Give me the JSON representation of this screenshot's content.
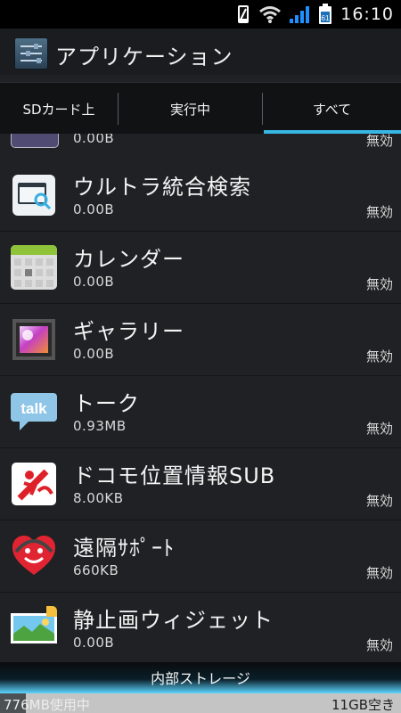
{
  "status_bar": {
    "time": "16:10",
    "battery_level": "61",
    "icons": [
      "phone-icon",
      "wifi-icon",
      "signal-icon",
      "battery-icon"
    ]
  },
  "app_bar": {
    "title": "アプリケーション",
    "icon": "settings-icon"
  },
  "tabs": [
    {
      "label": "SDカード上",
      "selected": false
    },
    {
      "label": "実行中",
      "selected": false
    },
    {
      "label": "すべて",
      "selected": true
    }
  ],
  "apps": [
    {
      "name": "",
      "size": "0.00B",
      "status": "無効",
      "icon": "partial-app-icon"
    },
    {
      "name": "ウルトラ統合検索",
      "size": "0.00B",
      "status": "無効",
      "icon": "search-window-icon"
    },
    {
      "name": "カレンダー",
      "size": "0.00B",
      "status": "無効",
      "icon": "calendar-icon"
    },
    {
      "name": "ギャラリー",
      "size": "0.00B",
      "status": "無効",
      "icon": "gallery-icon"
    },
    {
      "name": "トーク",
      "size": "0.93MB",
      "status": "無効",
      "icon": "talk-icon"
    },
    {
      "name": "ドコモ位置情報SUB",
      "size": "8.00KB",
      "status": "無効",
      "icon": "location-icon"
    },
    {
      "name": "遠隔ｻﾎﾟｰﾄ",
      "size": "660KB",
      "status": "無効",
      "icon": "heart-support-icon"
    },
    {
      "name": "静止画ウィジェット",
      "size": "0.00B",
      "status": "無効",
      "icon": "photo-widget-icon"
    }
  ],
  "storage": {
    "label": "内部ストレージ",
    "used_text": "776MB使用中",
    "free_text": "11GB空き",
    "used_fraction": 0.065
  },
  "colors": {
    "accent": "#39b7e4",
    "background": "#202124",
    "text": "#f4f4f4"
  }
}
